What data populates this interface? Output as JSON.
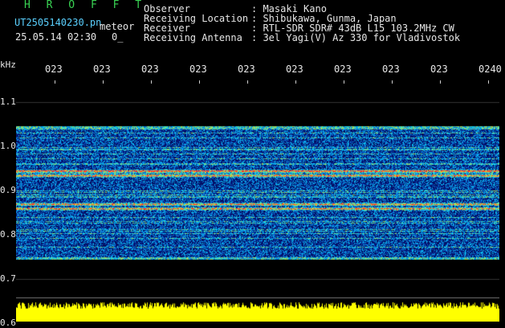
{
  "header": {
    "app_title": "H R O F F T",
    "file_name": "UT2505140230.pn",
    "file_suffix": "meteor",
    "date_time": "25.05.14 02:30",
    "count": "0_",
    "fields": [
      {
        "label": "Observer",
        "value": ": Masaki Kano"
      },
      {
        "label": "Receiving Location",
        "value": ": Shibukawa, Gunma, Japan"
      },
      {
        "label": "Receiver",
        "value": ": RTL-SDR SDR# 43dB L15 103.2MHz CW"
      },
      {
        "label": "Receiving Antenna",
        "value": ": 3el Yagi(V) Az 330 for Vladivostok"
      }
    ]
  },
  "chart_data": {
    "type": "heatmap",
    "ylabel": "kHz",
    "y_ticks": [
      "1.1",
      "1.0",
      "0.9",
      "0.8",
      "0.7",
      "0.6"
    ],
    "x_ticks": [
      "023",
      "023",
      "023",
      "023",
      "023",
      "023",
      "023",
      "023",
      "023",
      "0240"
    ],
    "ylim": [
      0.6,
      1.15
    ],
    "signal_band_khz": [
      0.745,
      1.045
    ],
    "strong_lines_khz": [
      0.945,
      0.935,
      0.87,
      0.86
    ],
    "colors": {
      "background": "#000000",
      "low": "#0a1a8c",
      "mid": "#18c8ff",
      "high": "#ff3333",
      "amplitude_bar": "#ffff00",
      "axis_text": "#e6e6e6"
    }
  }
}
